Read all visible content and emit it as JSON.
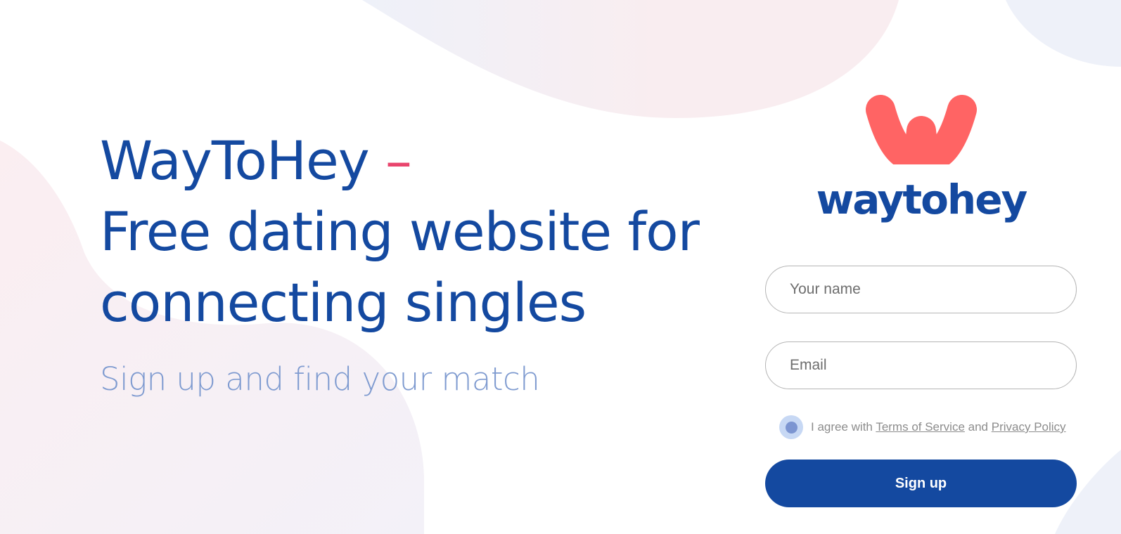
{
  "hero": {
    "title_line1": "WayToHey",
    "title_dash": "–",
    "title_line2": "Free dating website for",
    "title_line3": "connecting singles",
    "subtitle": "Sign up and find your match"
  },
  "brand": {
    "logo_icon": "w-logo-icon",
    "wordmark": "waytohey"
  },
  "form": {
    "name_placeholder": "Your name",
    "email_placeholder": "Email",
    "agree_prefix": "I agree with",
    "terms_link": "Terms of Service",
    "agree_and": "and",
    "privacy_link": "Privacy Policy",
    "signup_label": "Sign up"
  },
  "colors": {
    "primary": "#1449a0",
    "accent": "#e9456d",
    "logo": "#ff6464",
    "subtitle": "#7f9bd0",
    "toggle_bg": "#c7d8f4",
    "toggle_dot": "#7c95d1"
  }
}
